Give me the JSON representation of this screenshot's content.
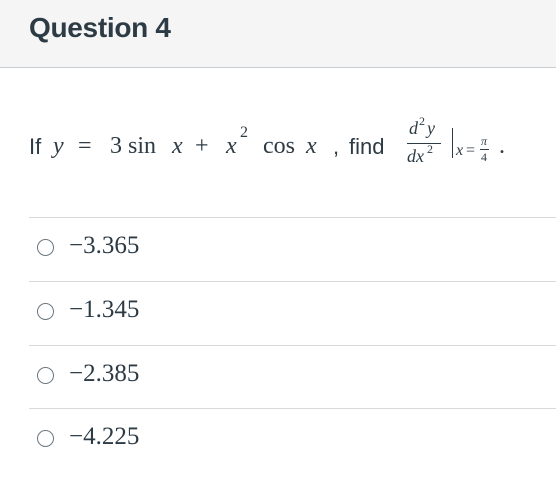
{
  "header": {
    "title": "Question 4"
  },
  "question": {
    "prefix": "If",
    "y_var": "y",
    "equals": "=",
    "expr_a": "3 sin",
    "x1": "x",
    "plus": "+",
    "x2": "x",
    "exp2": "2",
    "cos": "cos",
    "x3": "x",
    "comma": ",",
    "find": "find",
    "deriv_num_d": "d",
    "deriv_num_exp": "2",
    "deriv_num_y": "y",
    "deriv_den_dx": "dx",
    "deriv_den_exp": "2",
    "eval_x": "x",
    "eval_eq": "=",
    "eval_pi": "π",
    "eval_4": "4",
    "period": "."
  },
  "options": [
    {
      "label": "−3.365"
    },
    {
      "label": "−1.345"
    },
    {
      "label": "−2.385"
    },
    {
      "label": "−4.225"
    }
  ]
}
